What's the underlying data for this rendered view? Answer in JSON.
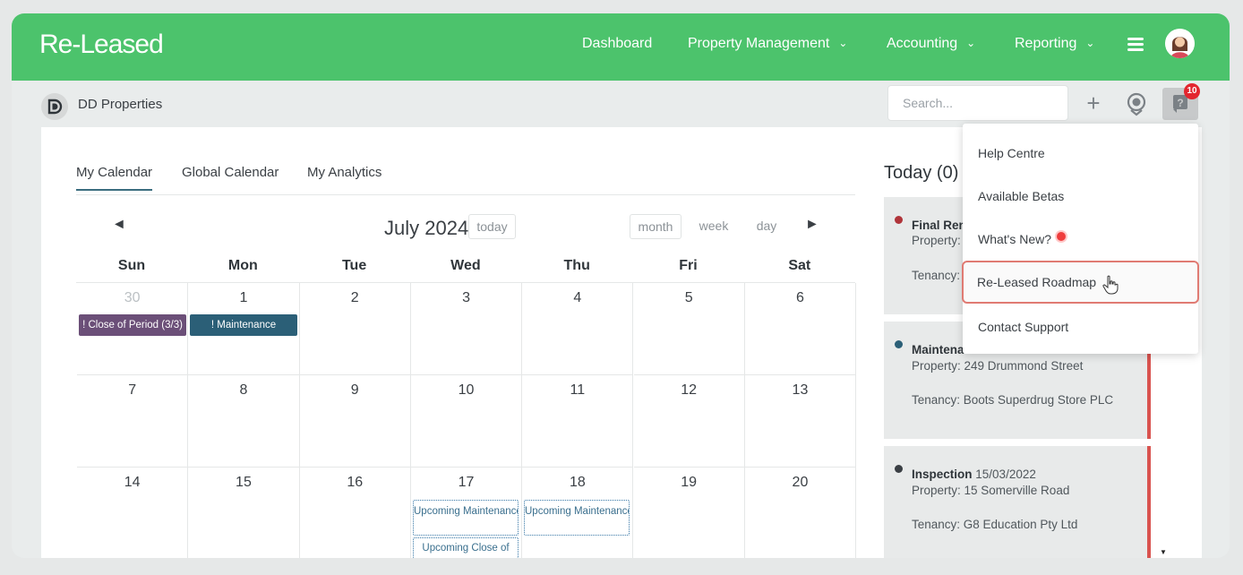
{
  "brand": "Re-Leased",
  "nav": {
    "items": [
      {
        "label": "Dashboard",
        "has_caret": false
      },
      {
        "label": "Property Management",
        "has_caret": true
      },
      {
        "label": "Accounting",
        "has_caret": true
      },
      {
        "label": "Reporting",
        "has_caret": true
      }
    ],
    "menu_icon": "hamburger-icon",
    "avatar_icon": "user-avatar"
  },
  "org": {
    "name": "DD Properties"
  },
  "search": {
    "placeholder": "Search..."
  },
  "notifications": {
    "count": "10"
  },
  "tabs": [
    {
      "label": "My Calendar",
      "active": true
    },
    {
      "label": "Global Calendar",
      "active": false
    },
    {
      "label": "My Analytics",
      "active": false
    }
  ],
  "calendar": {
    "title": "July 2024",
    "today_label": "today",
    "views": [
      "month",
      "week",
      "day"
    ],
    "prev_label": "◄",
    "next_label": "►",
    "days_of_week": [
      "Sun",
      "Mon",
      "Tue",
      "Wed",
      "Thu",
      "Fri",
      "Sat"
    ],
    "weeks": [
      [
        "30",
        "1",
        "2",
        "3",
        "4",
        "5",
        "6"
      ],
      [
        "7",
        "8",
        "9",
        "10",
        "11",
        "12",
        "13"
      ],
      [
        "14",
        "15",
        "16",
        "17",
        "18",
        "19",
        "20"
      ]
    ],
    "events": {
      "close_of_period": "! Close of Period (3/3)",
      "maintenance": "! Maintenance",
      "upcoming_maintenance_wed": "Upcoming Maintenance",
      "upcoming_maintenance_thu": "Upcoming Maintenance",
      "upcoming_close": "Upcoming Close of"
    }
  },
  "today": {
    "title": "Today (0)",
    "items": [
      {
        "type": "Final Ren",
        "date": "",
        "property": "Property: ",
        "tenancy": "Tenancy: ",
        "dot_color": "#b0343a"
      },
      {
        "type": "Maintena",
        "date": "",
        "property": "Property: 249 Drummond Street",
        "tenancy": "Tenancy: Boots Superdrug Store PLC",
        "dot_color": "#2b5f77"
      },
      {
        "type": "Inspection",
        "date": "15/03/2022",
        "property": "Property: 15 Somerville Road",
        "tenancy": "Tenancy: G8 Education Pty Ltd",
        "dot_color": "#3a3f44"
      }
    ]
  },
  "help_menu": {
    "items": [
      {
        "label": "Help Centre"
      },
      {
        "label": "Available Betas"
      },
      {
        "label": "What's New?"
      },
      {
        "label": "Re-Leased Roadmap"
      },
      {
        "label": "Contact Support"
      }
    ]
  },
  "colors": {
    "brand_green": "#4cc36c",
    "event_purple": "#6b4f78",
    "event_teal": "#2b5f77",
    "alert_red": "#d9534f"
  }
}
